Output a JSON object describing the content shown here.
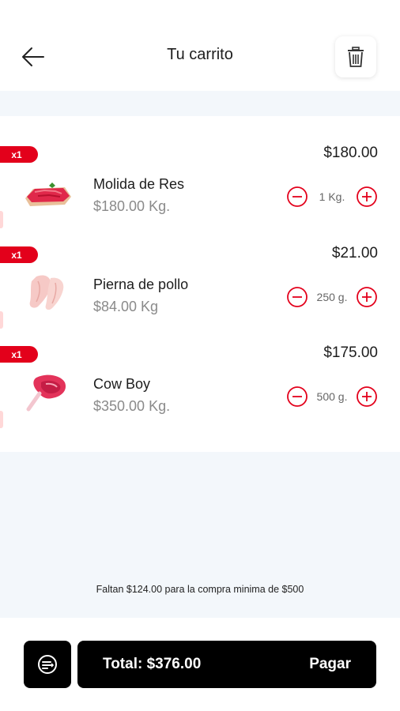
{
  "header": {
    "title": "Tu carrito",
    "back_icon": "arrow-left-icon",
    "trash_icon": "trash-icon"
  },
  "cart": {
    "items": [
      {
        "badge": "x1",
        "total": "$180.00",
        "name": "Molida de Res",
        "unit_price": "$180.00 Kg.",
        "quantity": "1 Kg.",
        "image": "ground-beef-icon"
      },
      {
        "badge": "x1",
        "total": "$21.00",
        "name": "Pierna de pollo",
        "unit_price": "$84.00 Kg",
        "quantity": "250 g.",
        "image": "chicken-leg-icon"
      },
      {
        "badge": "x1",
        "total": "$175.00",
        "name": "Cow Boy",
        "unit_price": "$350.00 Kg.",
        "quantity": "500 g.",
        "image": "cowboy-steak-icon"
      }
    ]
  },
  "min_note": "Faltan $124.00 para la compra minima de $500",
  "footer": {
    "total_label": "Total: $376.00",
    "pay_label": "Pagar",
    "promo_icon": "coupon-icon"
  },
  "colors": {
    "accent": "#e3001b",
    "band": "#f3f7fb",
    "button": "#000000"
  }
}
